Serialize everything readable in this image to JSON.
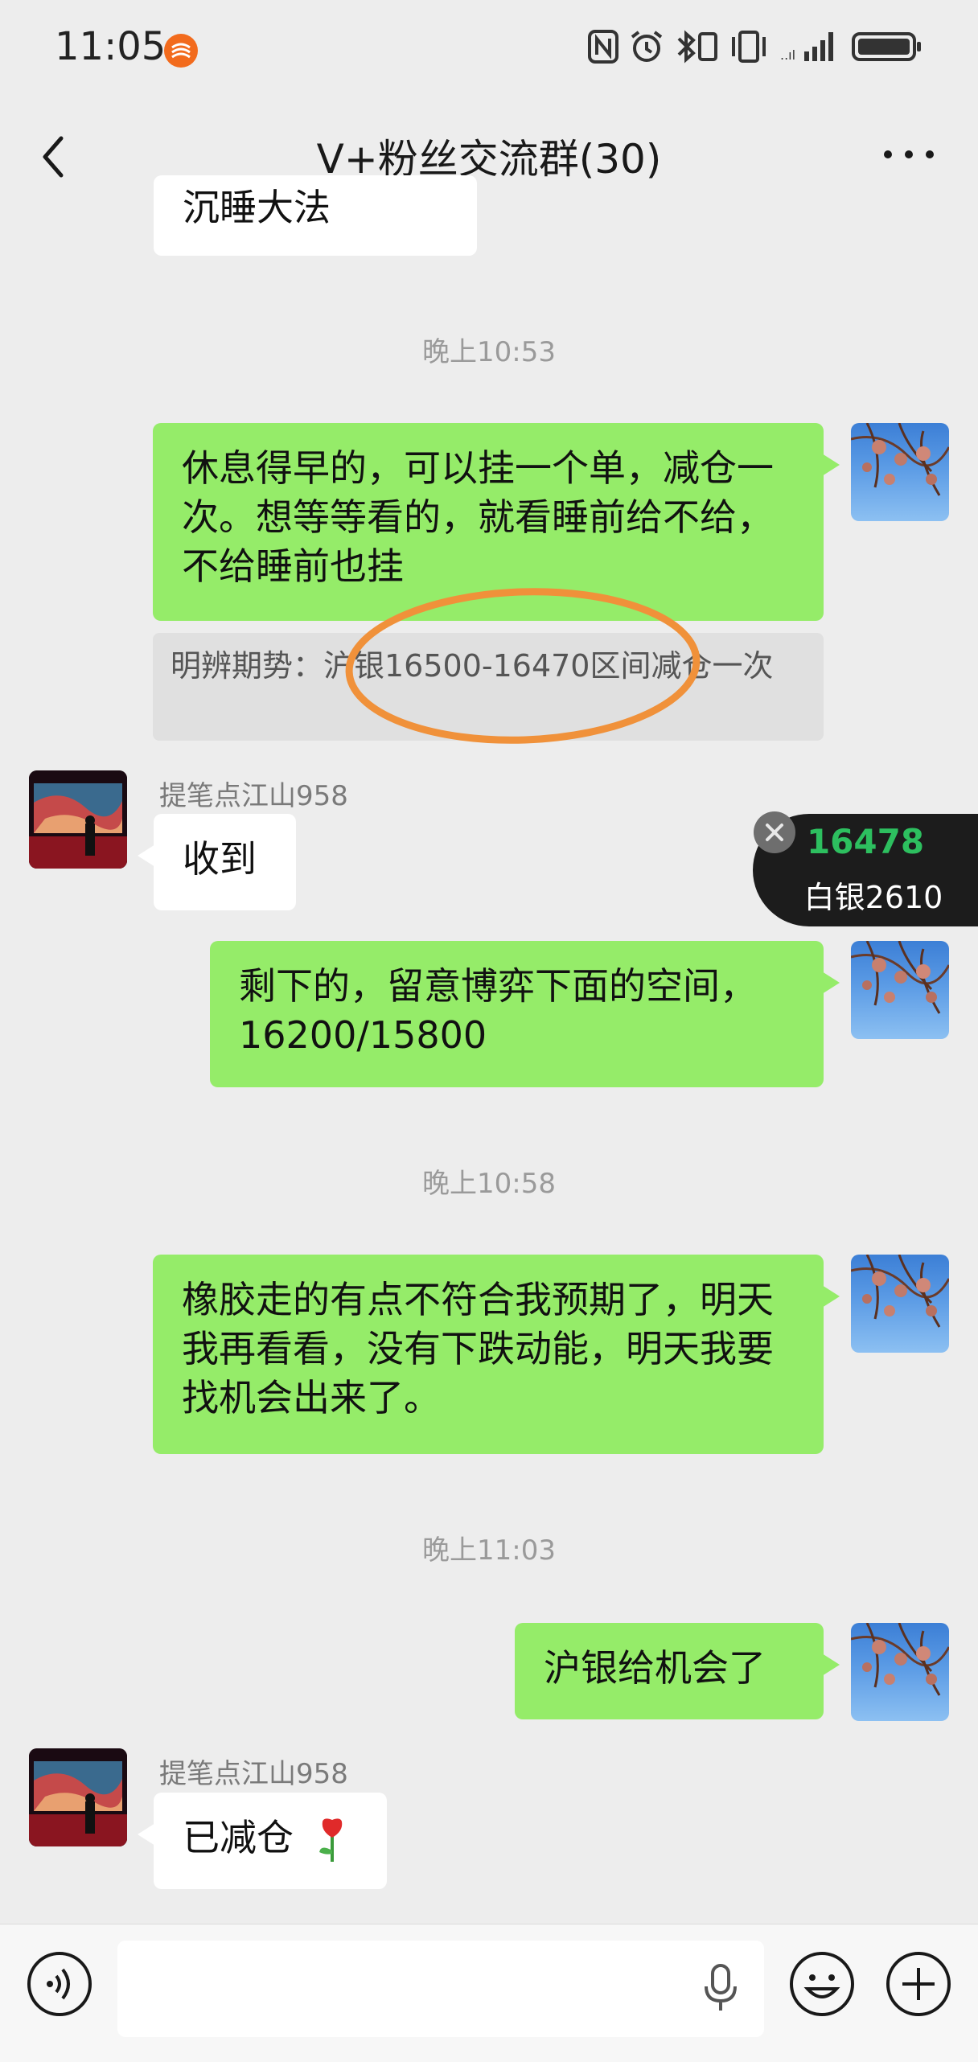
{
  "status_bar": {
    "time": "11:05",
    "icons": [
      "nfc-icon",
      "alarm-icon",
      "bluetooth-icon",
      "vibrate-icon",
      "signal-icon",
      "battery-icon"
    ]
  },
  "header": {
    "title": "V+粉丝交流群(30)",
    "back_icon": "chevron-left-icon",
    "more_icon": "more-icon"
  },
  "messages": {
    "partial_top_text": "沉睡大法",
    "time_1": "晚上10:53",
    "msg_1": "休息得早的，可以挂一个单，减仓一次。想等等看的，就看睡前给不给，不给睡前也挂",
    "quote_1": "明辨期势：沪银16500-16470区间减仓一次",
    "sender_1": "提笔点江山958",
    "msg_2": "收到",
    "msg_3": "剩下的，留意博弈下面的空间，16200/15800",
    "time_2": "晚上10:58",
    "msg_4": "橡胶走的有点不符合我预期了，明天我再看看，没有下跌动能，明天我要找机会出来了。",
    "time_3": "晚上11:03",
    "msg_5": "沪银给机会了",
    "sender_2": "提笔点江山958",
    "msg_6": "已减仓"
  },
  "ticker": {
    "price": "16478",
    "name": "白银2610",
    "price_color": "#2dbf5f"
  },
  "input_bar": {
    "voice_icon": "voice-icon",
    "mic_icon": "microphone-icon",
    "emoji_icon": "emoji-icon",
    "plus_icon": "plus-icon"
  },
  "colors": {
    "my_bubble": "#95ec69",
    "other_bubble": "#ffffff",
    "background": "#ededed",
    "highlight_ellipse": "#f0913a"
  }
}
